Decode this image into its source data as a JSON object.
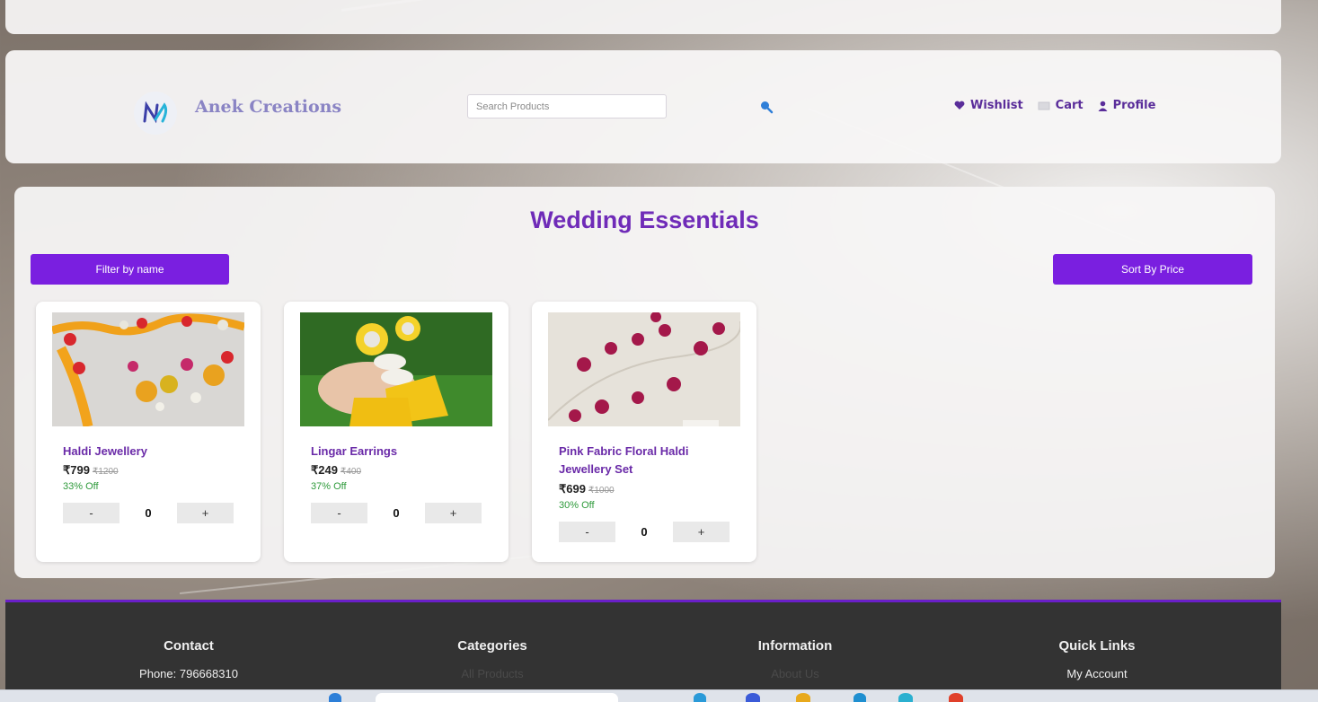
{
  "header": {
    "brand": "Anek Creations",
    "search_placeholder": "Search Products",
    "nav": [
      {
        "label": "Wishlist",
        "icon": "heart-icon"
      },
      {
        "label": "Cart",
        "icon": "cart-icon"
      },
      {
        "label": "Profile",
        "icon": "user-icon"
      }
    ]
  },
  "main": {
    "title": "Wedding Essentials",
    "filter_label": "Filter by name",
    "sort_label": "Sort By Price",
    "products": [
      {
        "name": "Haldi Jewellery",
        "price": "₹799",
        "mrp": "₹1200",
        "discount": "33% Off",
        "qty": "0",
        "minus": "-",
        "plus": "+"
      },
      {
        "name": "Lingar Earrings",
        "price": "₹249",
        "mrp": "₹400",
        "discount": "37% Off",
        "qty": "0",
        "minus": "-",
        "plus": "+"
      },
      {
        "name": "Pink Fabric Floral Haldi Jewellery Set",
        "price": "₹699",
        "mrp": "₹1000",
        "discount": "30% Off",
        "qty": "0",
        "minus": "-",
        "plus": "+"
      }
    ]
  },
  "footer": {
    "columns": [
      {
        "title": "Contact",
        "link": "Phone: 796668310"
      },
      {
        "title": "Categories",
        "link": "All Products"
      },
      {
        "title": "Information",
        "link": "About Us"
      },
      {
        "title": "Quick Links",
        "link": "My Account"
      }
    ]
  },
  "colors": {
    "accent": "#7a1fe0",
    "title": "#6f2bb8",
    "discount": "#2e9a3b",
    "footer_bg": "#333333"
  }
}
